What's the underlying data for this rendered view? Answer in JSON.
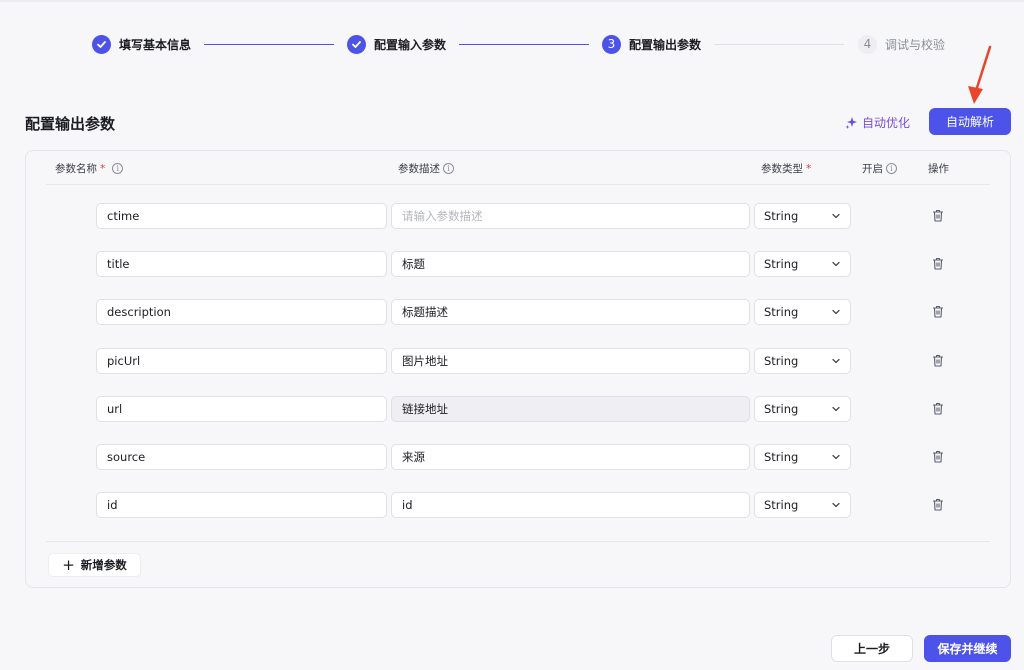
{
  "steps": [
    {
      "number": "",
      "label": "填写基本信息",
      "status": "done"
    },
    {
      "number": "",
      "label": "配置输入参数",
      "status": "done"
    },
    {
      "number": "3",
      "label": "配置输出参数",
      "status": "active"
    },
    {
      "number": "4",
      "label": "调试与校验",
      "status": "pending"
    }
  ],
  "header": {
    "title": "配置输出参数",
    "auto_optimize_label": "自动优化",
    "auto_parse_label": "自动解析"
  },
  "table": {
    "columns": {
      "name": "参数名称",
      "desc": "参数描述",
      "type": "参数类型",
      "enabled": "开启",
      "actions": "操作"
    },
    "required_mark": "*",
    "info_glyph": "i",
    "rows": [
      {
        "name": "ctime",
        "desc": "",
        "desc_placeholder": "请输入参数描述",
        "type": "String"
      },
      {
        "name": "title",
        "desc": "标题",
        "type": "String"
      },
      {
        "name": "description",
        "desc": "标题描述",
        "type": "String"
      },
      {
        "name": "picUrl",
        "desc": "图片地址",
        "type": "String"
      },
      {
        "name": "url",
        "desc": "链接地址",
        "type": "String",
        "disabled": true
      },
      {
        "name": "source",
        "desc": "来源",
        "type": "String"
      },
      {
        "name": "id",
        "desc": "id",
        "type": "String"
      }
    ],
    "add_label": "新增参数",
    "add_glyph": "+"
  },
  "footer": {
    "prev_label": "上一步",
    "save_label": "保存并继续"
  },
  "colors": {
    "accent": "#4d53e8",
    "optimize": "#7a4dd9",
    "required": "#e5383b",
    "annotation_arrow": "#e8452c"
  }
}
